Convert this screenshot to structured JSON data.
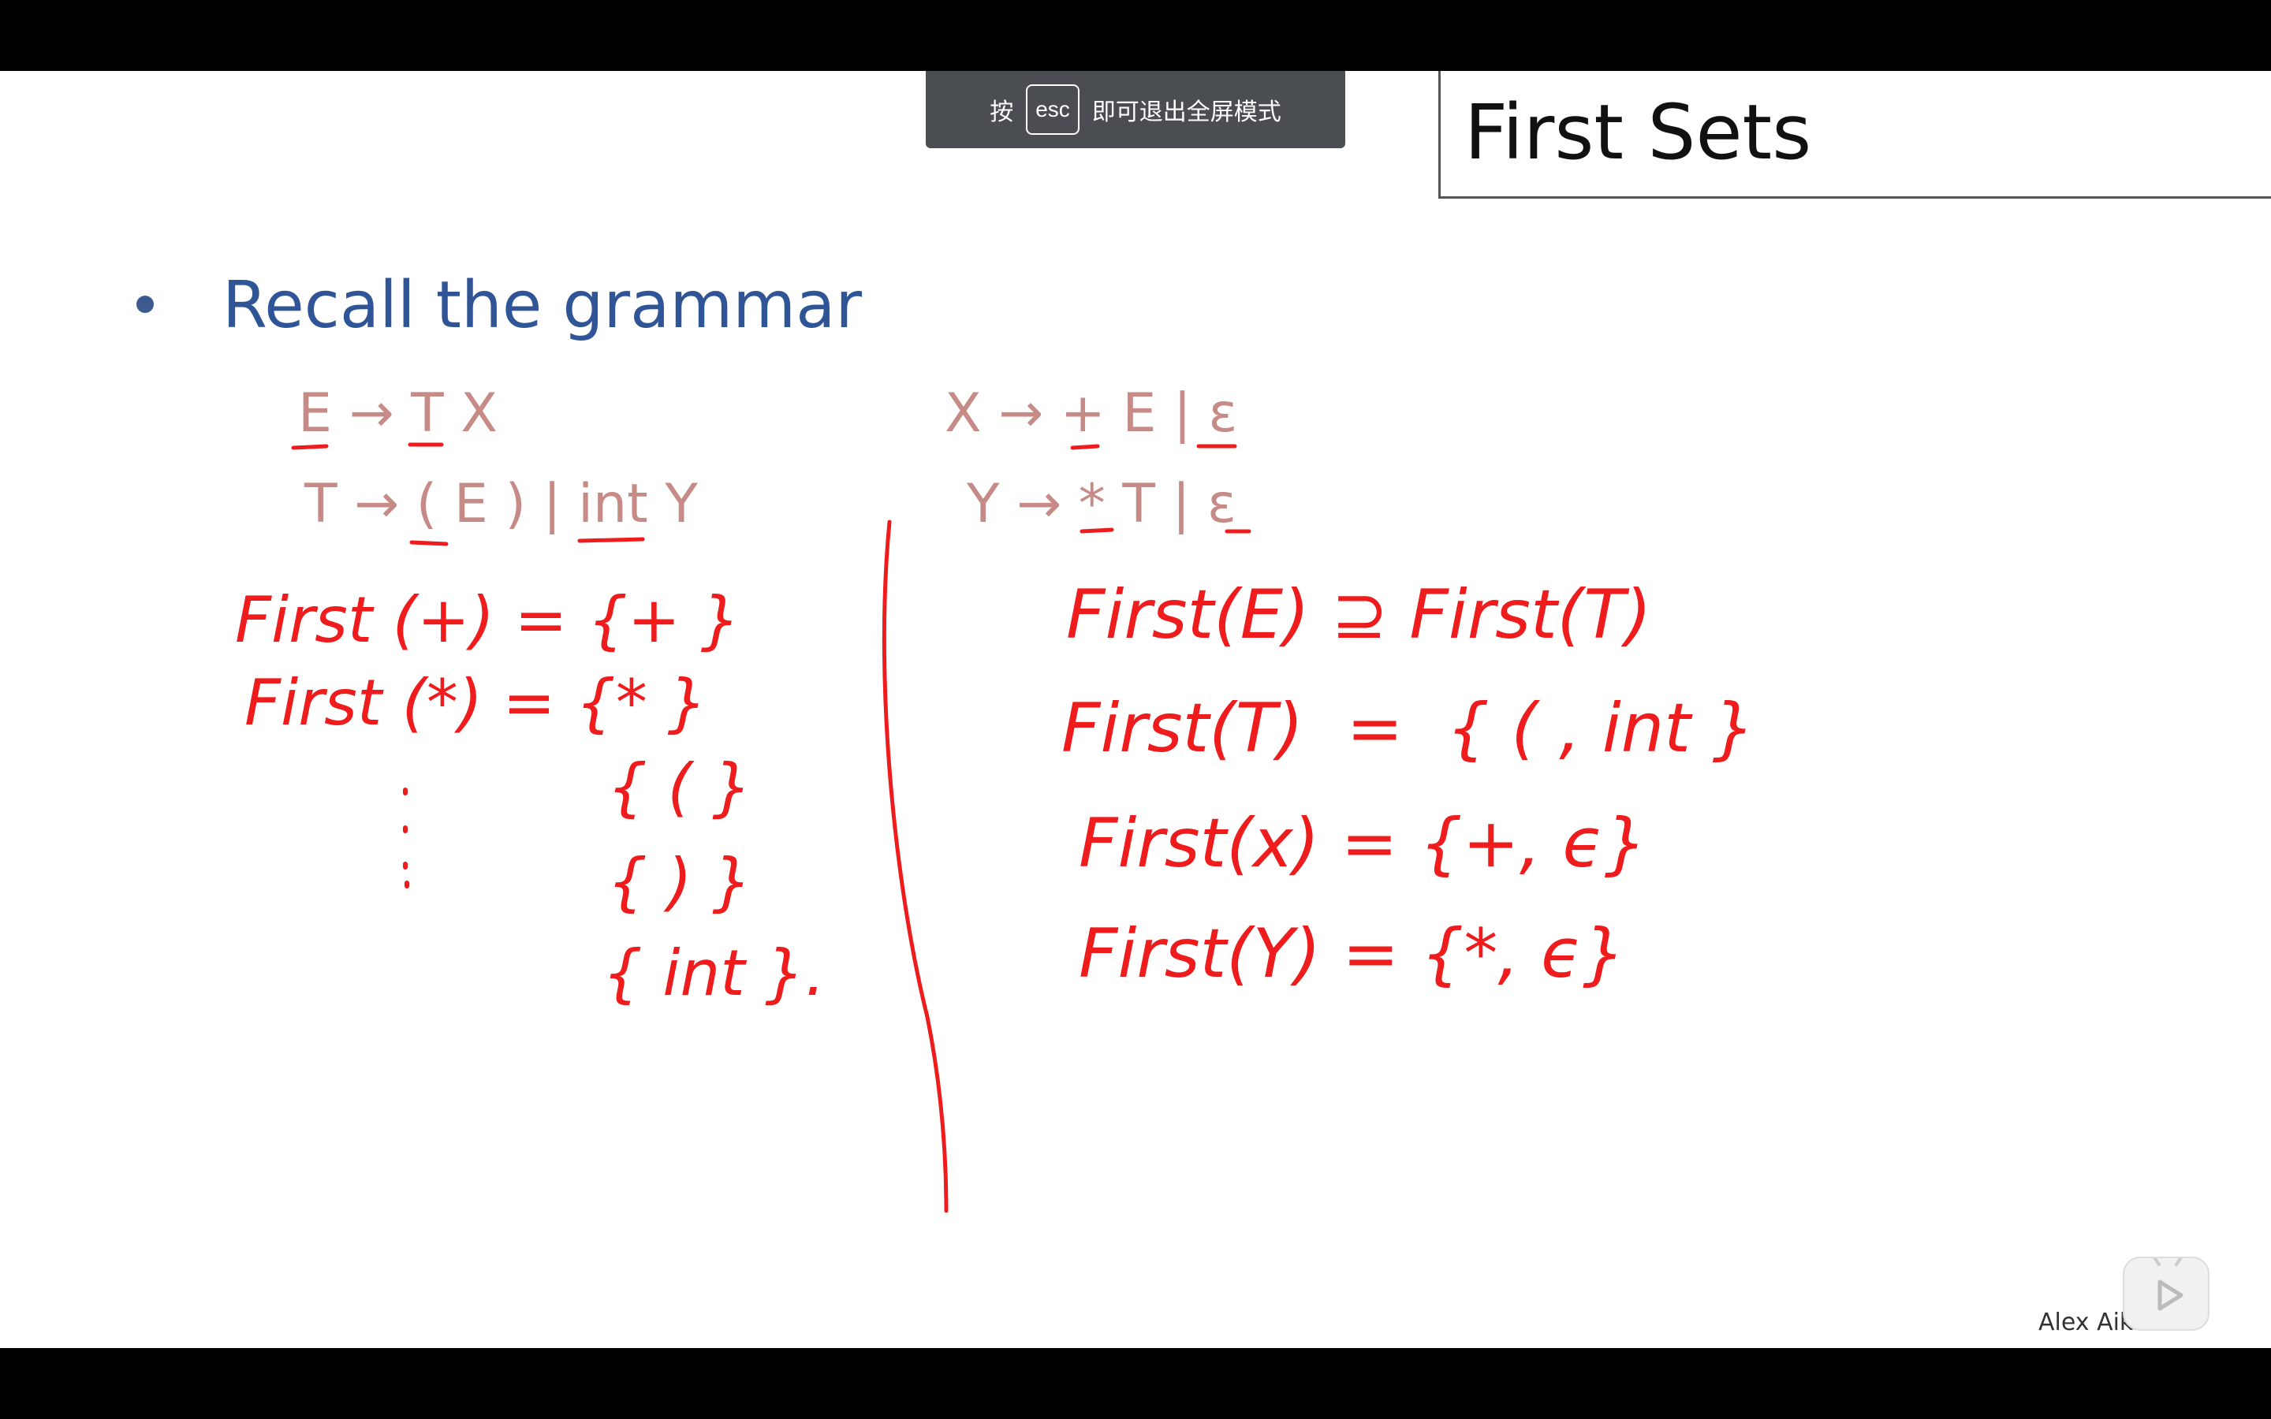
{
  "fullscreen_toast": {
    "prefix": "按",
    "key": "esc",
    "suffix": "即可退出全屏模式"
  },
  "slide": {
    "title": "First Sets",
    "bullet": "Recall the grammar",
    "grammar": {
      "rule_e": "E → T X",
      "rule_t": "T → ( E ) | int Y",
      "rule_x": "X → + E | ε",
      "rule_y": "Y → * T | ε"
    },
    "author": "Alex Aiken"
  },
  "handwriting": {
    "left": {
      "first_plus": "First (+) = {+ }",
      "first_star": "First (*) = {* }",
      "set_lparen": "{ ( }",
      "set_rparen": "{ ) }",
      "set_int": "{ int }."
    },
    "right": {
      "first_e": "First(E) ⊇ First(T)",
      "first_t": "First(T)  =  { ( , int }",
      "first_x": "First(x) = {+, ϵ}",
      "first_y": "First(Y) = {*, ϵ}"
    }
  },
  "colors": {
    "title_text": "#111111",
    "bullet_blue": "#2f5597",
    "grammar_pink": "#c68b87",
    "ink_red": "#ee1c1c",
    "toast_bg": "#4a4d51",
    "letterbox": "#000000"
  },
  "icons": {
    "player": "play-icon"
  }
}
